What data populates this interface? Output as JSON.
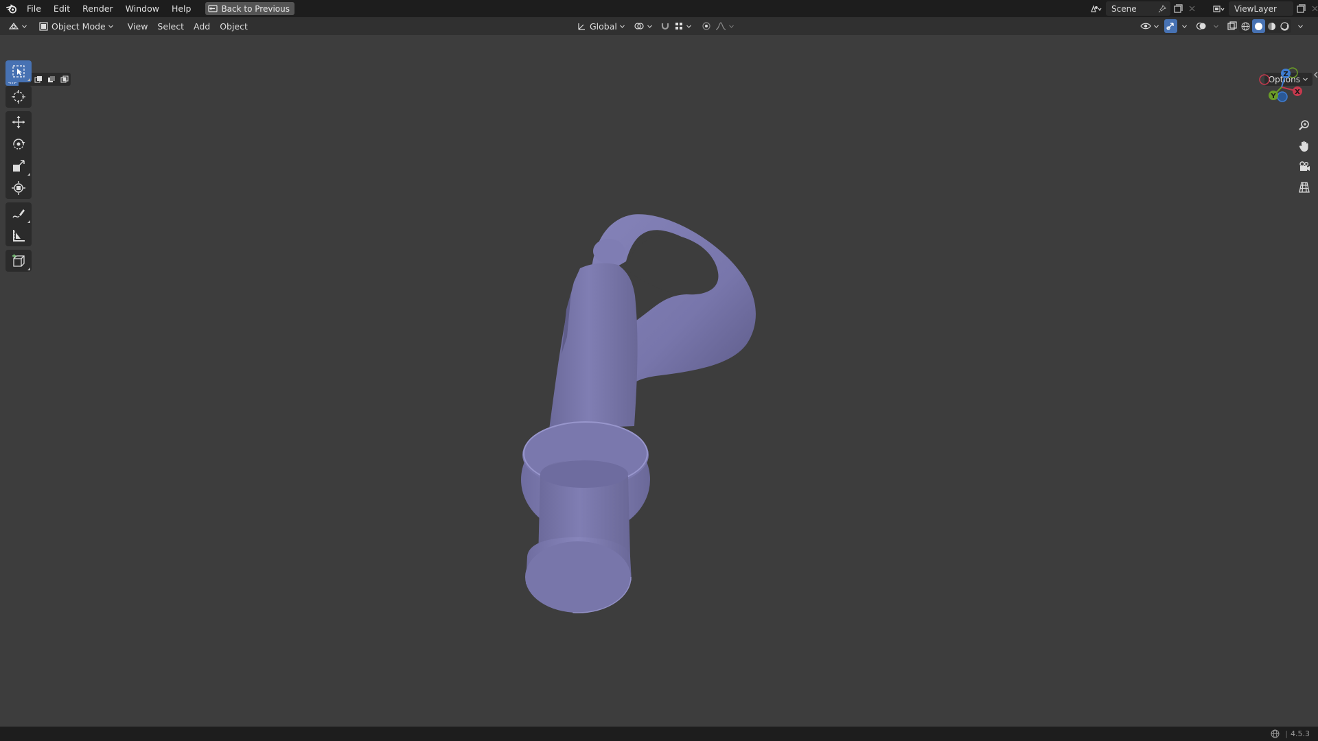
{
  "topbar": {
    "menu": [
      "File",
      "Edit",
      "Render",
      "Window",
      "Help"
    ],
    "back_button": "Back to Previous",
    "scene_name": "Scene",
    "view_layer_name": "ViewLayer"
  },
  "header": {
    "mode": "Object Mode",
    "menus": [
      "View",
      "Select",
      "Add",
      "Object"
    ],
    "transform_orientation": "Global"
  },
  "viewport": {
    "options_label": "Options",
    "gizmo": {
      "x": "X",
      "y": "Y",
      "z": "Z"
    },
    "object_color": "#7b79ac",
    "background_color": "#3d3d3d"
  },
  "toolbar": {
    "tools": [
      "select-box",
      "cursor",
      "move",
      "rotate",
      "scale",
      "transform",
      "annotate",
      "measure",
      "add-cube"
    ],
    "active_tool": "select-box"
  },
  "statusbar": {
    "version": "4.5.3"
  },
  "colors": {
    "accent": "#4772b3",
    "topbar": "#1d1d1d",
    "header": "#303030",
    "axis_x": "#c6394d",
    "axis_y": "#6a9d27",
    "axis_z": "#3f7dd1"
  }
}
